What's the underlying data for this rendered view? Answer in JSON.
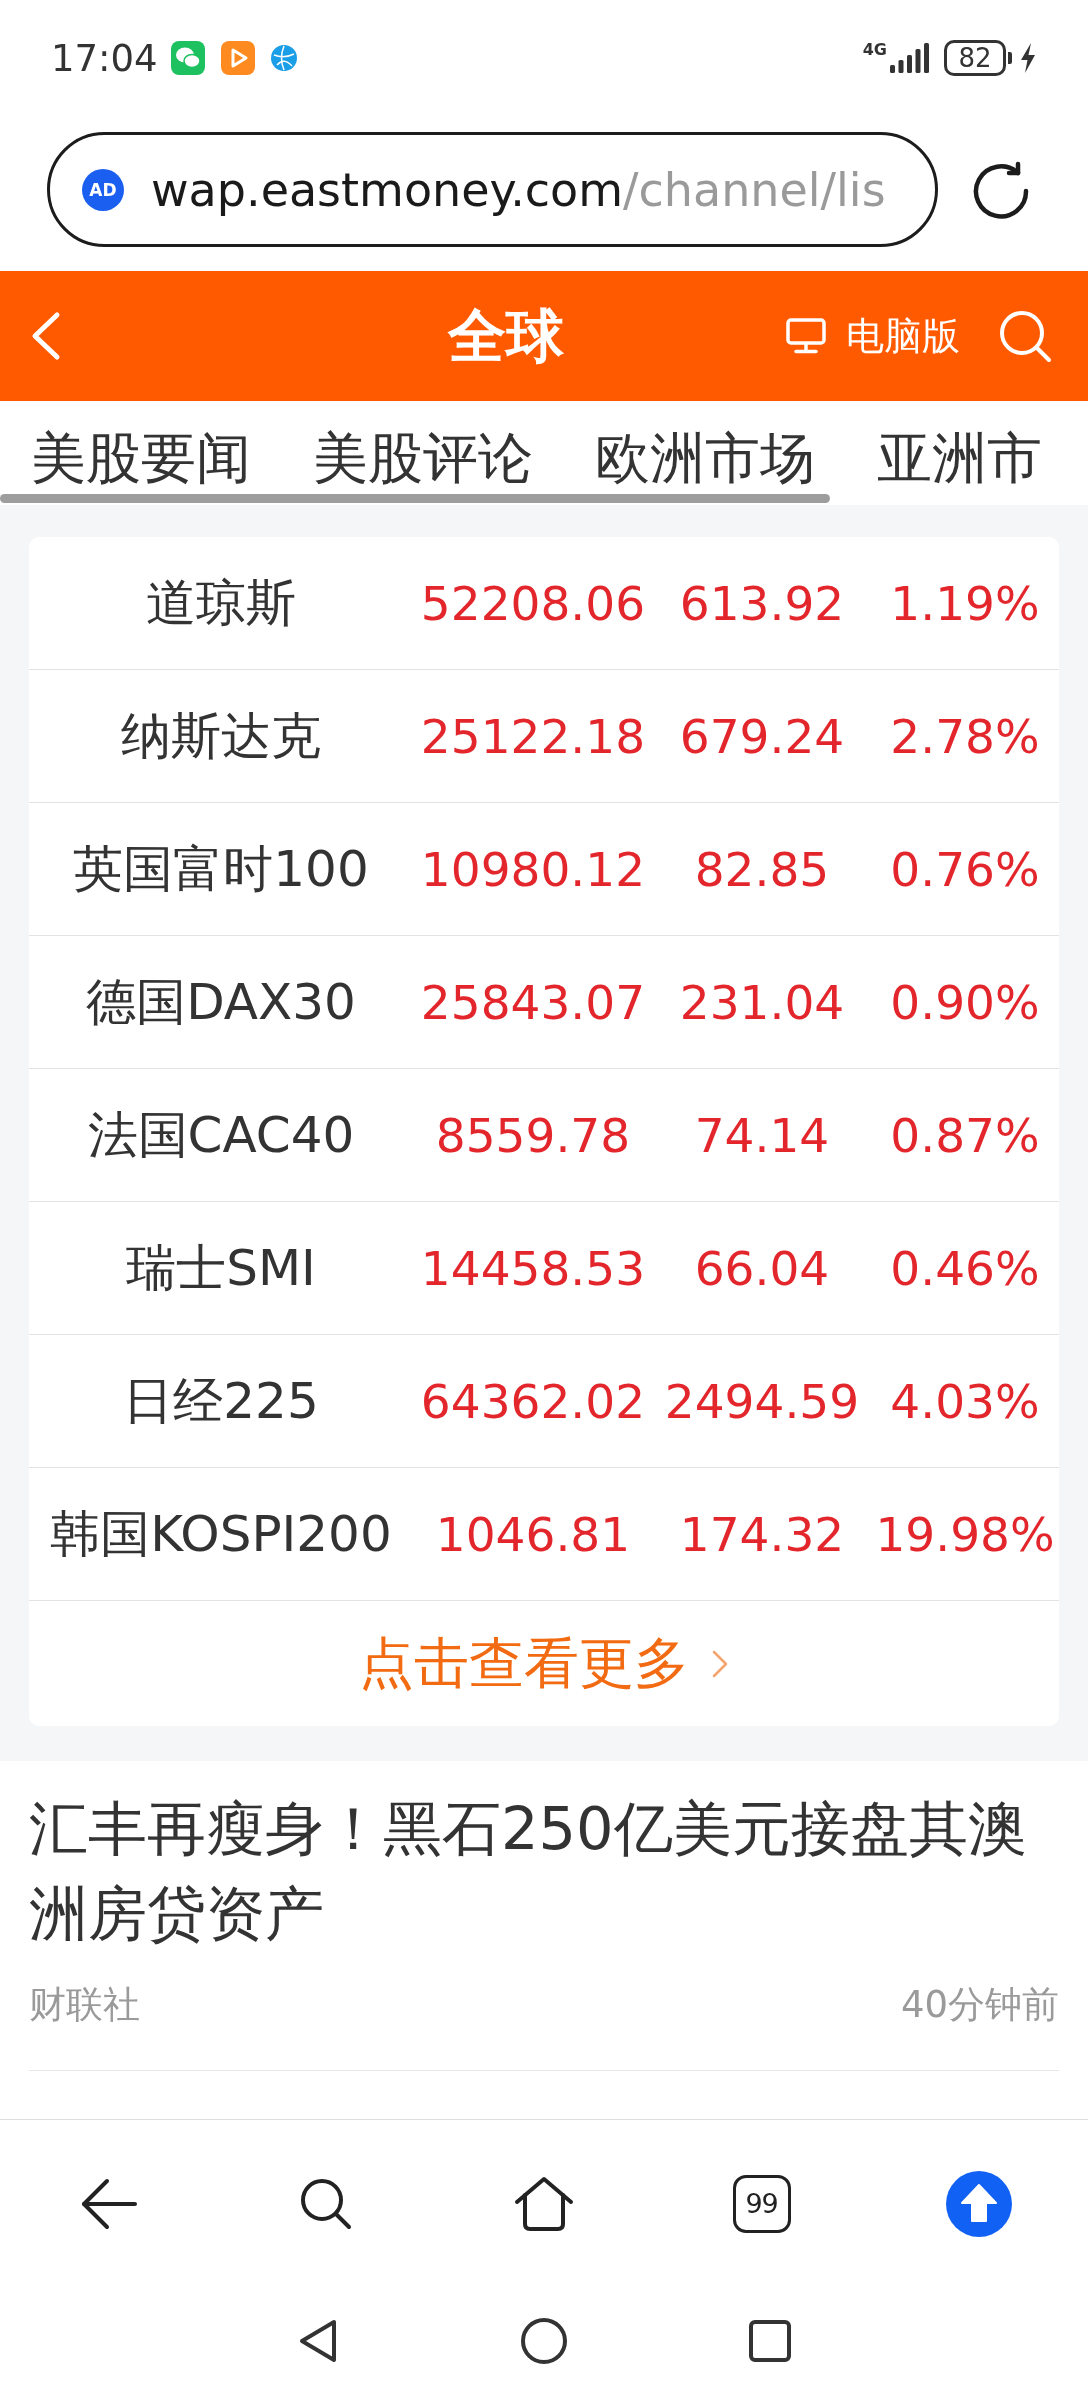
{
  "status_bar": {
    "time": "17:04",
    "network": "4G",
    "battery": "82"
  },
  "url_bar": {
    "badge": "AD",
    "host": "wap.eastmoney.com",
    "path": "/channel/lis"
  },
  "header": {
    "title": "全球",
    "desktop_link": "电脑版"
  },
  "tabs": [
    {
      "label": "美股要闻",
      "selected": false
    },
    {
      "label": "美股评论",
      "selected": false
    },
    {
      "label": "欧洲市场",
      "selected": false
    },
    {
      "label": "亚洲市",
      "selected": false
    }
  ],
  "indices": {
    "rows": [
      {
        "name": "道琼斯",
        "price": "52208.06",
        "change": "613.92",
        "percent": "1.19%",
        "rising": true
      },
      {
        "name": "纳斯达克",
        "price": "25122.18",
        "change": "679.24",
        "percent": "2.78%",
        "rising": true
      },
      {
        "name": "英国富时100",
        "price": "10980.12",
        "change": "82.85",
        "percent": "0.76%",
        "rising": true
      },
      {
        "name": "德国DAX30",
        "price": "25843.07",
        "change": "231.04",
        "percent": "0.90%",
        "rising": true
      },
      {
        "name": "法国CAC40",
        "price": "8559.78",
        "change": "74.14",
        "percent": "0.87%",
        "rising": true
      },
      {
        "name": "瑞士SMI",
        "price": "14458.53",
        "change": "66.04",
        "percent": "0.46%",
        "rising": true
      },
      {
        "name": "日经225",
        "price": "64362.02",
        "change": "2494.59",
        "percent": "4.03%",
        "rising": true
      },
      {
        "name": "韩国KOSPI200",
        "price": "1046.81",
        "change": "174.32",
        "percent": "19.98%",
        "rising": true
      }
    ],
    "more_link": "点击查看更多"
  },
  "news": [
    {
      "headline": "汇丰再瘦身！黑石250亿美元接盘其澳洲房贷资产",
      "source": "财联社",
      "time": "40分钟前"
    }
  ],
  "toolbar": {
    "tab_count": "99"
  }
}
